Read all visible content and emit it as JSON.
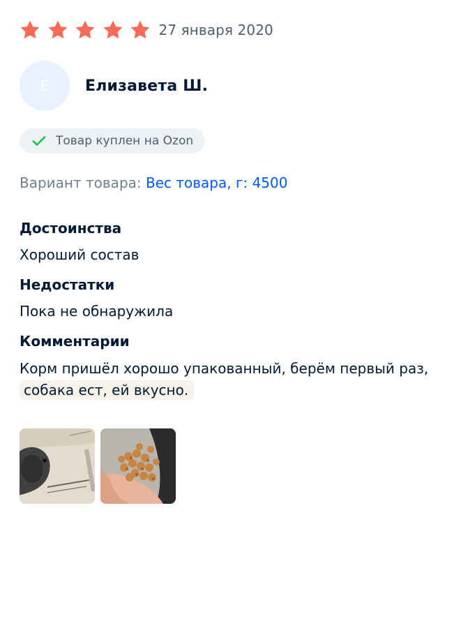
{
  "review": {
    "rating": 5,
    "max_rating": 5,
    "date": "27 января 2020",
    "author": {
      "initial": "Е",
      "name": "Елизавета Ш."
    },
    "badge": {
      "icon": "check-icon",
      "label": "Товар куплен на Ozon"
    },
    "variant": {
      "label": "Вариант товара:",
      "value": "Вес товара, г: 4500"
    },
    "sections": {
      "pros": {
        "title": "Достоинства",
        "text": "Хороший состав"
      },
      "cons": {
        "title": "Недостатки",
        "text": "Пока не обнаружила"
      },
      "comment": {
        "title": "Комментарии",
        "text_main": "Корм пришёл хорошо упакованный, берём первый раз,",
        "text_highlight": "собака ест, ей вкусно."
      }
    },
    "photos": [
      {
        "icon": "dog-food-bag-photo"
      },
      {
        "icon": "kibble-in-hand-photo"
      }
    ]
  },
  "colors": {
    "star": "#f66b57",
    "check": "#10c44c",
    "link": "#005bff",
    "text": "#001a34",
    "muted": "#707f8d",
    "badge_bg": "#eef2f4",
    "avatar_bg": "#e9f0fe",
    "highlight_bg": "#f7f3ea"
  }
}
